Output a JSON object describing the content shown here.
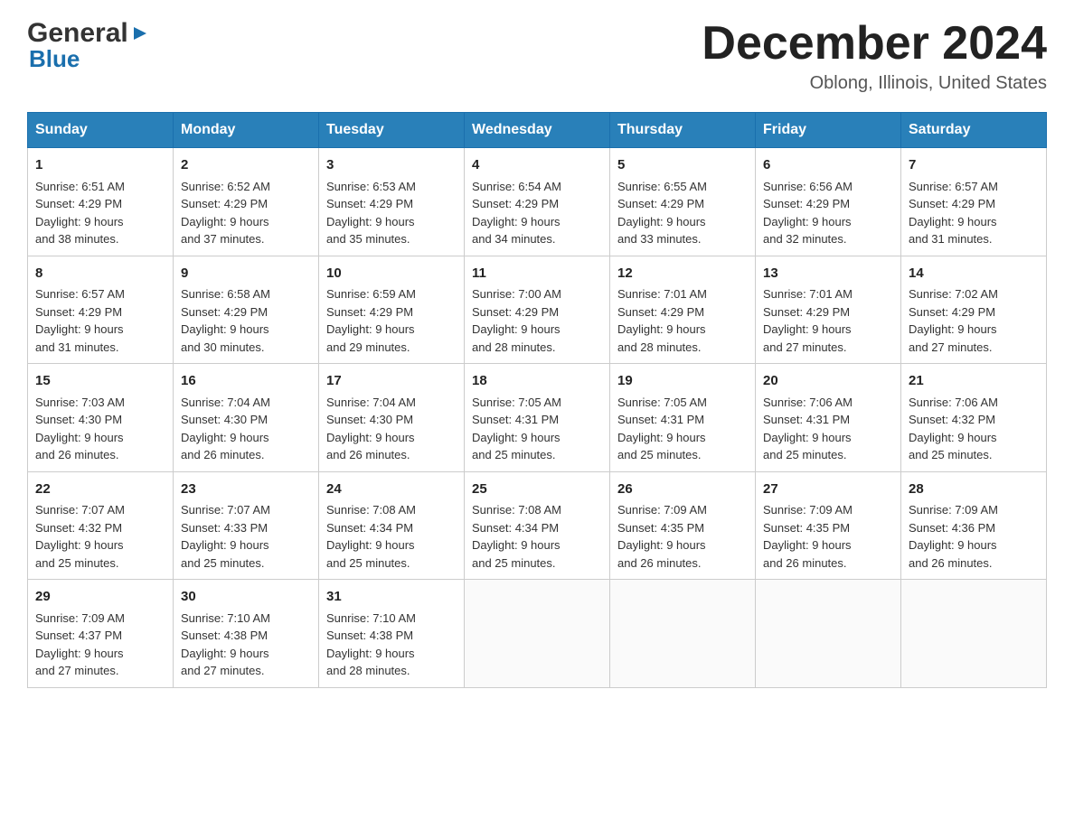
{
  "header": {
    "logo_general": "General",
    "logo_blue": "Blue",
    "month_title": "December 2024",
    "location": "Oblong, Illinois, United States"
  },
  "days_of_week": [
    "Sunday",
    "Monday",
    "Tuesday",
    "Wednesday",
    "Thursday",
    "Friday",
    "Saturday"
  ],
  "weeks": [
    [
      {
        "day": "1",
        "sunrise": "6:51 AM",
        "sunset": "4:29 PM",
        "daylight": "9 hours and 38 minutes."
      },
      {
        "day": "2",
        "sunrise": "6:52 AM",
        "sunset": "4:29 PM",
        "daylight": "9 hours and 37 minutes."
      },
      {
        "day": "3",
        "sunrise": "6:53 AM",
        "sunset": "4:29 PM",
        "daylight": "9 hours and 35 minutes."
      },
      {
        "day": "4",
        "sunrise": "6:54 AM",
        "sunset": "4:29 PM",
        "daylight": "9 hours and 34 minutes."
      },
      {
        "day": "5",
        "sunrise": "6:55 AM",
        "sunset": "4:29 PM",
        "daylight": "9 hours and 33 minutes."
      },
      {
        "day": "6",
        "sunrise": "6:56 AM",
        "sunset": "4:29 PM",
        "daylight": "9 hours and 32 minutes."
      },
      {
        "day": "7",
        "sunrise": "6:57 AM",
        "sunset": "4:29 PM",
        "daylight": "9 hours and 31 minutes."
      }
    ],
    [
      {
        "day": "8",
        "sunrise": "6:57 AM",
        "sunset": "4:29 PM",
        "daylight": "9 hours and 31 minutes."
      },
      {
        "day": "9",
        "sunrise": "6:58 AM",
        "sunset": "4:29 PM",
        "daylight": "9 hours and 30 minutes."
      },
      {
        "day": "10",
        "sunrise": "6:59 AM",
        "sunset": "4:29 PM",
        "daylight": "9 hours and 29 minutes."
      },
      {
        "day": "11",
        "sunrise": "7:00 AM",
        "sunset": "4:29 PM",
        "daylight": "9 hours and 28 minutes."
      },
      {
        "day": "12",
        "sunrise": "7:01 AM",
        "sunset": "4:29 PM",
        "daylight": "9 hours and 28 minutes."
      },
      {
        "day": "13",
        "sunrise": "7:01 AM",
        "sunset": "4:29 PM",
        "daylight": "9 hours and 27 minutes."
      },
      {
        "day": "14",
        "sunrise": "7:02 AM",
        "sunset": "4:29 PM",
        "daylight": "9 hours and 27 minutes."
      }
    ],
    [
      {
        "day": "15",
        "sunrise": "7:03 AM",
        "sunset": "4:30 PM",
        "daylight": "9 hours and 26 minutes."
      },
      {
        "day": "16",
        "sunrise": "7:04 AM",
        "sunset": "4:30 PM",
        "daylight": "9 hours and 26 minutes."
      },
      {
        "day": "17",
        "sunrise": "7:04 AM",
        "sunset": "4:30 PM",
        "daylight": "9 hours and 26 minutes."
      },
      {
        "day": "18",
        "sunrise": "7:05 AM",
        "sunset": "4:31 PM",
        "daylight": "9 hours and 25 minutes."
      },
      {
        "day": "19",
        "sunrise": "7:05 AM",
        "sunset": "4:31 PM",
        "daylight": "9 hours and 25 minutes."
      },
      {
        "day": "20",
        "sunrise": "7:06 AM",
        "sunset": "4:31 PM",
        "daylight": "9 hours and 25 minutes."
      },
      {
        "day": "21",
        "sunrise": "7:06 AM",
        "sunset": "4:32 PM",
        "daylight": "9 hours and 25 minutes."
      }
    ],
    [
      {
        "day": "22",
        "sunrise": "7:07 AM",
        "sunset": "4:32 PM",
        "daylight": "9 hours and 25 minutes."
      },
      {
        "day": "23",
        "sunrise": "7:07 AM",
        "sunset": "4:33 PM",
        "daylight": "9 hours and 25 minutes."
      },
      {
        "day": "24",
        "sunrise": "7:08 AM",
        "sunset": "4:34 PM",
        "daylight": "9 hours and 25 minutes."
      },
      {
        "day": "25",
        "sunrise": "7:08 AM",
        "sunset": "4:34 PM",
        "daylight": "9 hours and 25 minutes."
      },
      {
        "day": "26",
        "sunrise": "7:09 AM",
        "sunset": "4:35 PM",
        "daylight": "9 hours and 26 minutes."
      },
      {
        "day": "27",
        "sunrise": "7:09 AM",
        "sunset": "4:35 PM",
        "daylight": "9 hours and 26 minutes."
      },
      {
        "day": "28",
        "sunrise": "7:09 AM",
        "sunset": "4:36 PM",
        "daylight": "9 hours and 26 minutes."
      }
    ],
    [
      {
        "day": "29",
        "sunrise": "7:09 AM",
        "sunset": "4:37 PM",
        "daylight": "9 hours and 27 minutes."
      },
      {
        "day": "30",
        "sunrise": "7:10 AM",
        "sunset": "4:38 PM",
        "daylight": "9 hours and 27 minutes."
      },
      {
        "day": "31",
        "sunrise": "7:10 AM",
        "sunset": "4:38 PM",
        "daylight": "9 hours and 28 minutes."
      },
      null,
      null,
      null,
      null
    ]
  ]
}
